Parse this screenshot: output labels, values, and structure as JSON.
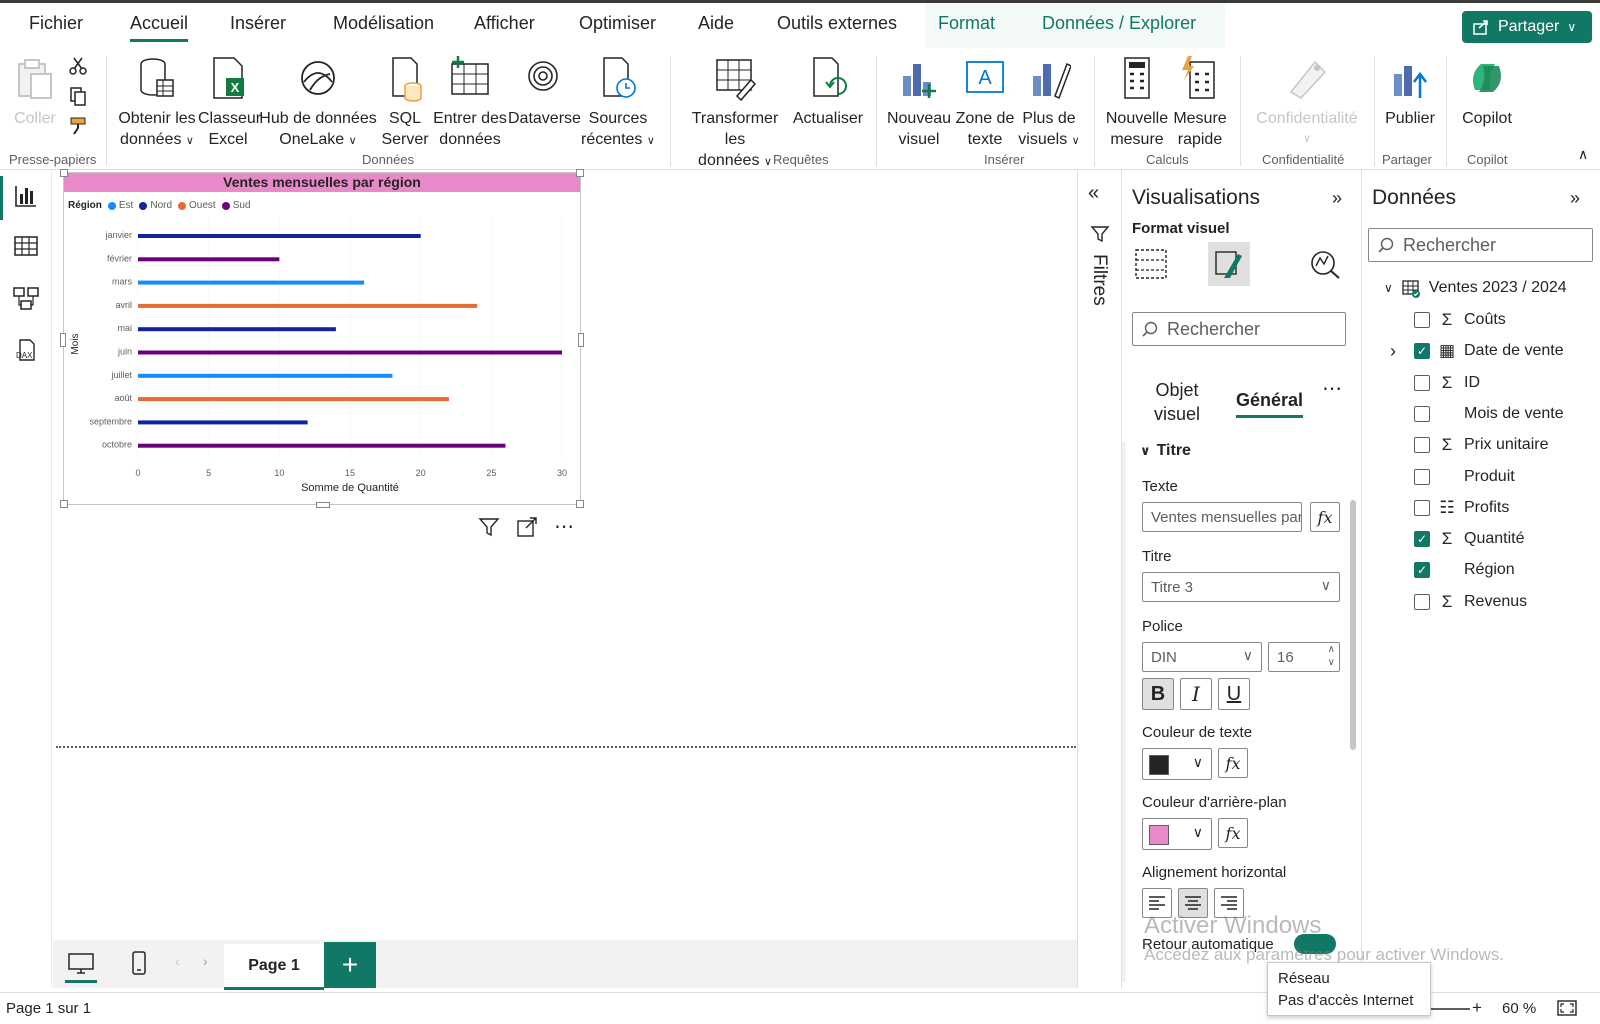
{
  "menu": {
    "tabs": [
      "Fichier",
      "Accueil",
      "Insérer",
      "Modélisation",
      "Afficher",
      "Optimiser",
      "Aide",
      "Outils externes",
      "Format",
      "Données / Explorer"
    ],
    "share_label": "Partager"
  },
  "ribbon": {
    "coller": "Coller",
    "obtenir": [
      "Obtenir les",
      "données"
    ],
    "classeur": [
      "Classeur",
      "Excel"
    ],
    "hub": [
      "Hub de données",
      "OneLake"
    ],
    "sql": [
      "SQL",
      "Server"
    ],
    "entrer": [
      "Entrer des",
      "données"
    ],
    "dataverse": "Dataverse",
    "sources": [
      "Sources",
      "récentes"
    ],
    "transformer": [
      "Transformer les",
      "données"
    ],
    "actualiser": "Actualiser",
    "nouveau_visuel": [
      "Nouveau",
      "visuel"
    ],
    "zone_texte": [
      "Zone de",
      "texte"
    ],
    "plus_visuels": [
      "Plus de",
      "visuels"
    ],
    "nouvelle_mesure": [
      "Nouvelle",
      "mesure"
    ],
    "mesure_rapide": [
      "Mesure",
      "rapide"
    ],
    "confidentialite": "Confidentialité",
    "publier": "Publier",
    "copilot": "Copilot",
    "groups": {
      "presse": "Presse-papiers",
      "donnees": "Données",
      "requetes": "Requêtes",
      "inserer": "Insérer",
      "calculs": "Calculs",
      "confidentialite": "Confidentialité",
      "partager": "Partager",
      "copilot": "Copilot"
    }
  },
  "chart_data": {
    "type": "bar",
    "orientation": "horizontal",
    "title": "Ventes mensuelles par région",
    "title_background": "#E88AC9",
    "legend_title": "Région",
    "legend_position": "top-left",
    "ylabel": "Mois",
    "xlabel": "Somme de Quantité",
    "xlim": [
      0,
      30
    ],
    "xticks": [
      0,
      5,
      10,
      15,
      20,
      25,
      30
    ],
    "categories": [
      "janvier",
      "février",
      "mars",
      "avril",
      "mai",
      "juin",
      "juillet",
      "août",
      "septembre",
      "octobre"
    ],
    "series": [
      {
        "name": "Est",
        "color": "#118DFF",
        "values": [
          null,
          null,
          16,
          null,
          null,
          null,
          18,
          null,
          null,
          null
        ]
      },
      {
        "name": "Nord",
        "color": "#12239E",
        "values": [
          20,
          null,
          null,
          null,
          14,
          null,
          null,
          null,
          12,
          null
        ]
      },
      {
        "name": "Ouest",
        "color": "#E66C37",
        "values": [
          null,
          null,
          null,
          24,
          null,
          null,
          null,
          22,
          null,
          null
        ]
      },
      {
        "name": "Sud",
        "color": "#6B007B",
        "values": [
          null,
          10,
          null,
          null,
          null,
          30,
          null,
          null,
          null,
          26
        ]
      }
    ]
  },
  "bottom": {
    "page_tab": "Page 1",
    "add": "+",
    "status": "Page 1 sur 1",
    "zoom": "60 %",
    "zoom_plus": "+"
  },
  "filters": {
    "label": "Filtres"
  },
  "viz": {
    "title": "Visualisations",
    "format_label": "Format visuel",
    "search_placeholder": "Rechercher",
    "tab_objet": [
      "Objet",
      "visuel"
    ],
    "tab_general": "Général",
    "more": "⋯",
    "section": "Titre",
    "texte_label": "Texte",
    "texte_value": "Ventes mensuelles par région",
    "titre_label": "Titre",
    "titre_value": "Titre 3",
    "police_label": "Police",
    "police_value": "DIN",
    "police_size": "16",
    "bold": "B",
    "italic": "I",
    "underline": "U",
    "couleur_texte_label": "Couleur de texte",
    "couleur_texte": "#252423",
    "couleur_fond_label": "Couleur d'arrière-plan",
    "couleur_fond": "#E88AC9",
    "align_label": "Alignement horizontal",
    "retour_label": "Retour automatique",
    "fx": "fx"
  },
  "data": {
    "title": "Données",
    "search_placeholder": "Rechercher",
    "table": "Ventes 2023 / 2024",
    "fields": [
      {
        "name": "Coûts",
        "checked": false,
        "icon": "sigma"
      },
      {
        "name": "Date de vente",
        "checked": true,
        "icon": "calendar"
      },
      {
        "name": "ID",
        "checked": false,
        "icon": "sigma"
      },
      {
        "name": "Mois de vente",
        "checked": false,
        "icon": "none"
      },
      {
        "name": "Prix unitaire",
        "checked": false,
        "icon": "sigma"
      },
      {
        "name": "Produit",
        "checked": false,
        "icon": "none"
      },
      {
        "name": "Profits",
        "checked": false,
        "icon": "calc"
      },
      {
        "name": "Quantité",
        "checked": true,
        "icon": "sigma"
      },
      {
        "name": "Région",
        "checked": true,
        "icon": "none"
      },
      {
        "name": "Revenus",
        "checked": false,
        "icon": "sigma"
      }
    ]
  },
  "overlay": {
    "watermark1": "Activer Windows",
    "watermark2": "Accédez aux paramètres pour activer Windows.",
    "tooltip_line1": "Réseau",
    "tooltip_line2": "Pas d'accès Internet"
  }
}
